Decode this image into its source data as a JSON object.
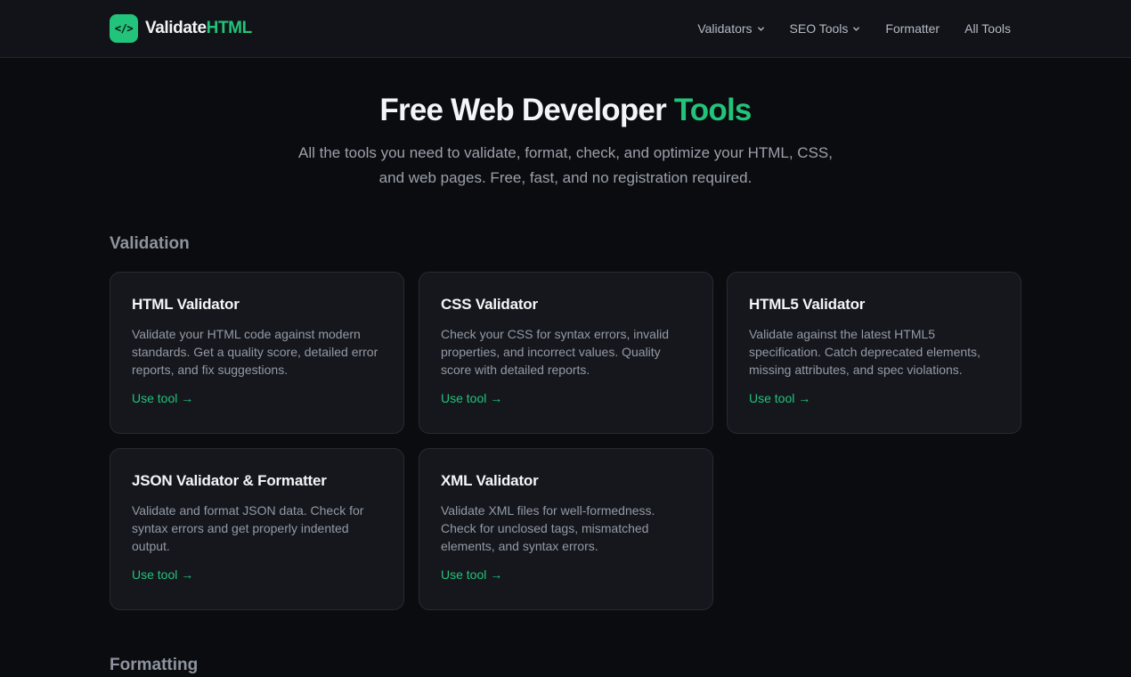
{
  "header": {
    "logo_mark": "</>",
    "logo_text": "Validate",
    "logo_accent": "HTML",
    "nav": [
      {
        "label": "Validators",
        "has_dropdown": true
      },
      {
        "label": "SEO Tools",
        "has_dropdown": true
      },
      {
        "label": "Formatter",
        "has_dropdown": false
      },
      {
        "label": "All Tools",
        "has_dropdown": false
      }
    ]
  },
  "hero": {
    "title": "Free Web Developer ",
    "title_accent": "Tools",
    "subtitle_line1": "All the tools you need to validate, format, check, and optimize your HTML, CSS,",
    "subtitle_line2": "and web pages. Free, fast, and no registration required."
  },
  "sections": [
    {
      "title": "Validation",
      "cards": [
        {
          "title": "HTML Validator",
          "description": "Validate your HTML code against modern standards. Get a quality score, detailed error reports, and fix suggestions.",
          "link": "Use tool →"
        },
        {
          "title": "CSS Validator",
          "description": "Check your CSS for syntax errors, invalid properties, and incorrect values. Quality score with detailed reports.",
          "link": "Use tool →"
        },
        {
          "title": "HTML5 Validator",
          "description": "Validate against the latest HTML5 specification. Catch deprecated elements, missing attributes, and spec violations.",
          "link": "Use tool →"
        },
        {
          "title": "JSON Validator & Formatter",
          "description": "Validate and format JSON data. Check for syntax errors and get properly indented output.",
          "link": "Use tool →"
        },
        {
          "title": "XML Validator",
          "description": "Validate XML files for well-formedness. Check for unclosed tags, mismatched elements, and syntax errors.",
          "link": "Use tool →"
        }
      ]
    },
    {
      "title": "Formatting",
      "cards": []
    }
  ],
  "colors": {
    "accent": "#22c37a",
    "background": "#0b0c0f",
    "card": "#15171d",
    "header": "#111318"
  }
}
